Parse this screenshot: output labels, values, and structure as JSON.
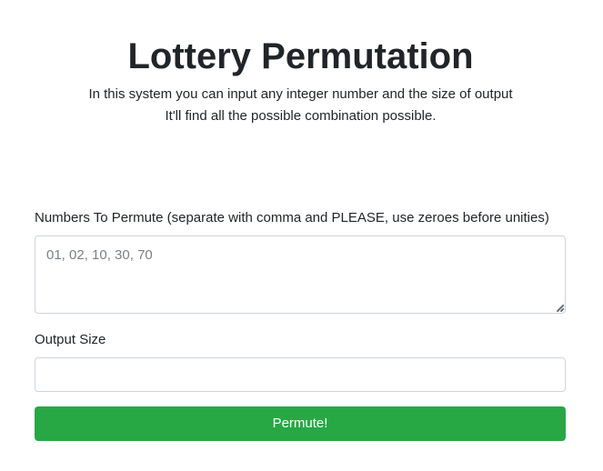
{
  "header": {
    "title": "Lottery Permutation",
    "description_line_1": "In this system you can input any integer number and the size of output",
    "description_line_2": "It'll find all the possible combination possible."
  },
  "form": {
    "numbers": {
      "label": "Numbers To Permute (separate with comma and PLEASE, use zeroes before unities)",
      "placeholder": "01, 02, 10, 30, 70",
      "value": ""
    },
    "output_size": {
      "label": "Output Size",
      "value": ""
    },
    "submit_label": "Permute!"
  },
  "colors": {
    "submit_button": "#28a745",
    "text": "#212529",
    "input_border": "#ced4da"
  }
}
